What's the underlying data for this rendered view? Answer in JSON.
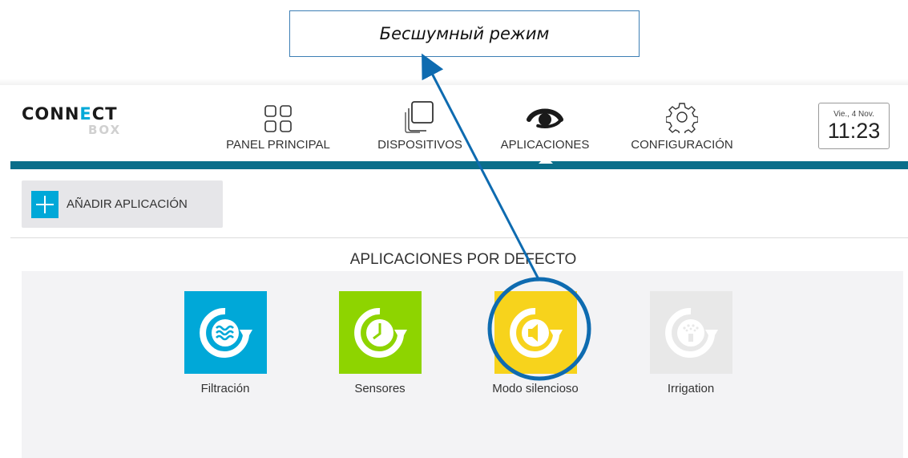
{
  "annotation": {
    "callout_text": "Бесшумный режим"
  },
  "logo": {
    "line1_a": "CONN",
    "line1_b": "E",
    "line1_c": "CT",
    "line2": "BOX"
  },
  "nav": [
    {
      "label": "PANEL PRINCIPAL",
      "icon": "grid-icon"
    },
    {
      "label": "DISPOSITIVOS",
      "icon": "devices-icon"
    },
    {
      "label": "APLICACIONES",
      "icon": "eye-icon"
    },
    {
      "label": "CONFIGURACIÓN",
      "icon": "gear-icon"
    }
  ],
  "clock": {
    "date": "Vie., 4 Nov.",
    "time": "11:23"
  },
  "toolbar": {
    "add_label": "AÑADIR APLICACIÓN"
  },
  "section": {
    "title": "APLICACIONES POR DEFECTO"
  },
  "apps": [
    {
      "name": "Filtración",
      "icon": "waves-refresh-icon",
      "color": "#00a8d8"
    },
    {
      "name": "Sensores",
      "icon": "clock-refresh-icon",
      "color": "#8ed400"
    },
    {
      "name": "Modo silencioso",
      "icon": "speaker-refresh-icon",
      "color": "#f7d31c"
    },
    {
      "name": "Irrigation",
      "icon": "sprinkler-refresh-icon",
      "color": "#e8e8e8"
    }
  ],
  "colors": {
    "accent": "#00a8d8",
    "bar": "#0a6e8a",
    "highlight": "#0e6bb0"
  }
}
